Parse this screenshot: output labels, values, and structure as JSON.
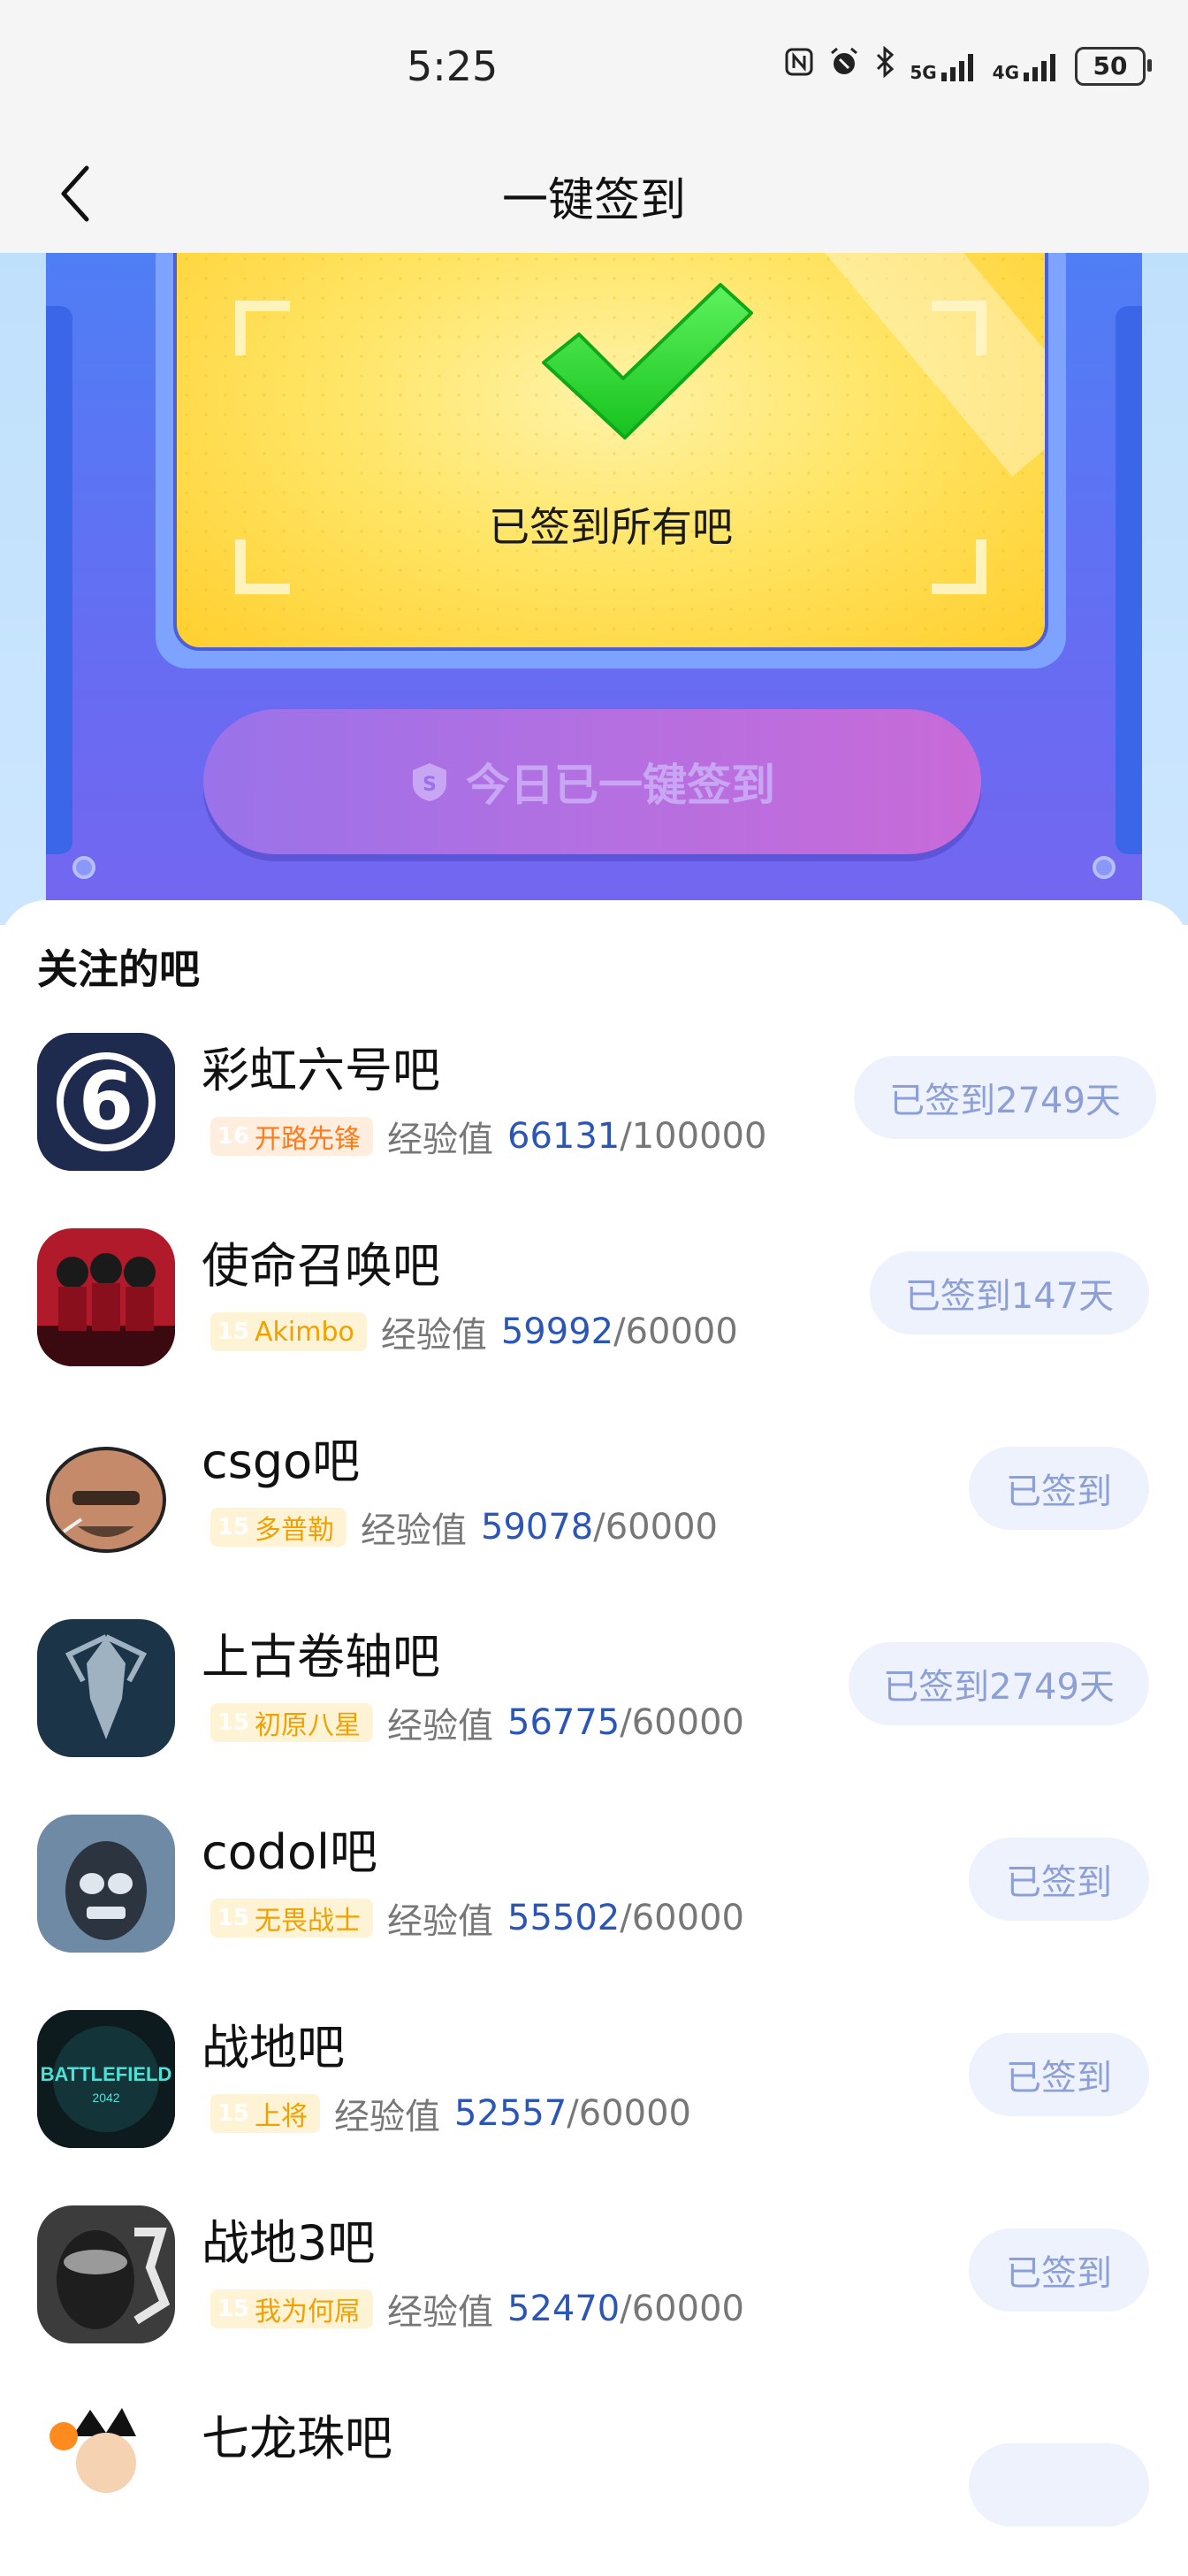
{
  "status_bar": {
    "time": "5:25",
    "icons": [
      "nfc-icon",
      "alarm-icon",
      "bluetooth-icon",
      "5g-signal-icon",
      "4g-signal-icon"
    ],
    "net1": "5G",
    "net2": "4G",
    "battery": "50"
  },
  "header": {
    "title": "一键签到"
  },
  "hero": {
    "message": "已签到所有吧",
    "button_label": "今日已一键签到"
  },
  "section": {
    "title": "关注的吧"
  },
  "forums": [
    {
      "name": "彩虹六号吧",
      "level": "16",
      "title": "开路先锋",
      "exp_label": "经验值",
      "exp_current": "66131",
      "exp_max": "/100000",
      "status": "已签到2749天",
      "badge_color": "orange"
    },
    {
      "name": "使命召唤吧",
      "level": "15",
      "title": "Akimbo",
      "exp_label": "经验值",
      "exp_current": "59992",
      "exp_max": "/60000",
      "status": "已签到147天",
      "badge_color": "yellow"
    },
    {
      "name": "csgo吧",
      "level": "15",
      "title": "多普勒",
      "exp_label": "经验值",
      "exp_current": "59078",
      "exp_max": "/60000",
      "status": "已签到",
      "badge_color": "yellow"
    },
    {
      "name": "上古卷轴吧",
      "level": "15",
      "title": "初原八星",
      "exp_label": "经验值",
      "exp_current": "56775",
      "exp_max": "/60000",
      "status": "已签到2749天",
      "badge_color": "yellow"
    },
    {
      "name": "codol吧",
      "level": "15",
      "title": "无畏战士",
      "exp_label": "经验值",
      "exp_current": "55502",
      "exp_max": "/60000",
      "status": "已签到",
      "badge_color": "yellow"
    },
    {
      "name": "战地吧",
      "level": "15",
      "title": "上将",
      "exp_label": "经验值",
      "exp_current": "52557",
      "exp_max": "/60000",
      "status": "已签到",
      "badge_color": "yellow"
    },
    {
      "name": "战地3吧",
      "level": "15",
      "title": "我为何屌",
      "exp_label": "经验值",
      "exp_current": "52470",
      "exp_max": "/60000",
      "status": "已签到",
      "badge_color": "yellow"
    },
    {
      "name": "七龙珠吧"
    }
  ],
  "avatar_texts": {
    "battlefield_line1": "BATTLEFIELD",
    "battlefield_line2": "2042"
  }
}
